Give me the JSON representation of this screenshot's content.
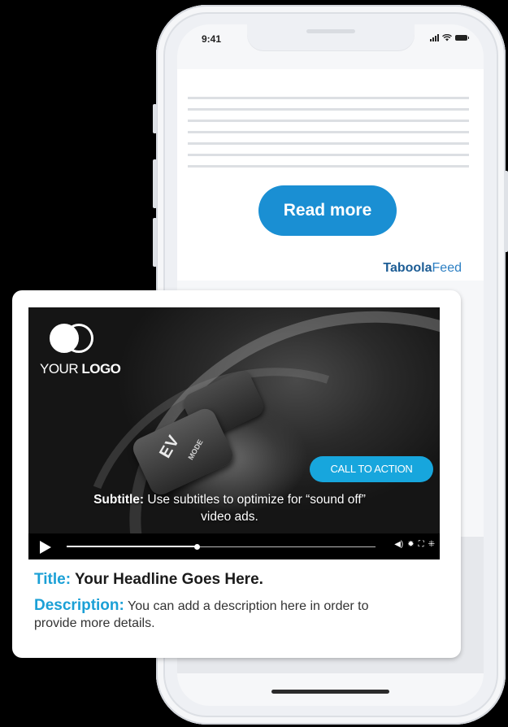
{
  "status_bar": {
    "time": "9:41"
  },
  "article": {
    "read_more_label": "Read more",
    "brand": {
      "part1": "Taboola",
      "part2": "Feed"
    }
  },
  "ad_card": {
    "logo": {
      "text_light": "YOUR ",
      "text_bold": "LOGO"
    },
    "video": {
      "button_label": "EV",
      "button_sublabel": "MODE",
      "cta_label": "CALL TO ACTION",
      "subtitle_label": "Subtitle:",
      "subtitle_text": " Use subtitles to optimize for “sound off” video ads.",
      "progress": 0.42
    },
    "title_label": "Title:",
    "title_text": " Your Headline Goes Here.",
    "description_label": "Description:",
    "description_text": " You can add a description here in order to provide more details."
  },
  "colors": {
    "accent_blue": "#1a8fd3",
    "cta_blue": "#17a6dd",
    "label_blue": "#1ba0d6",
    "brand_navy": "#1d5d95"
  }
}
